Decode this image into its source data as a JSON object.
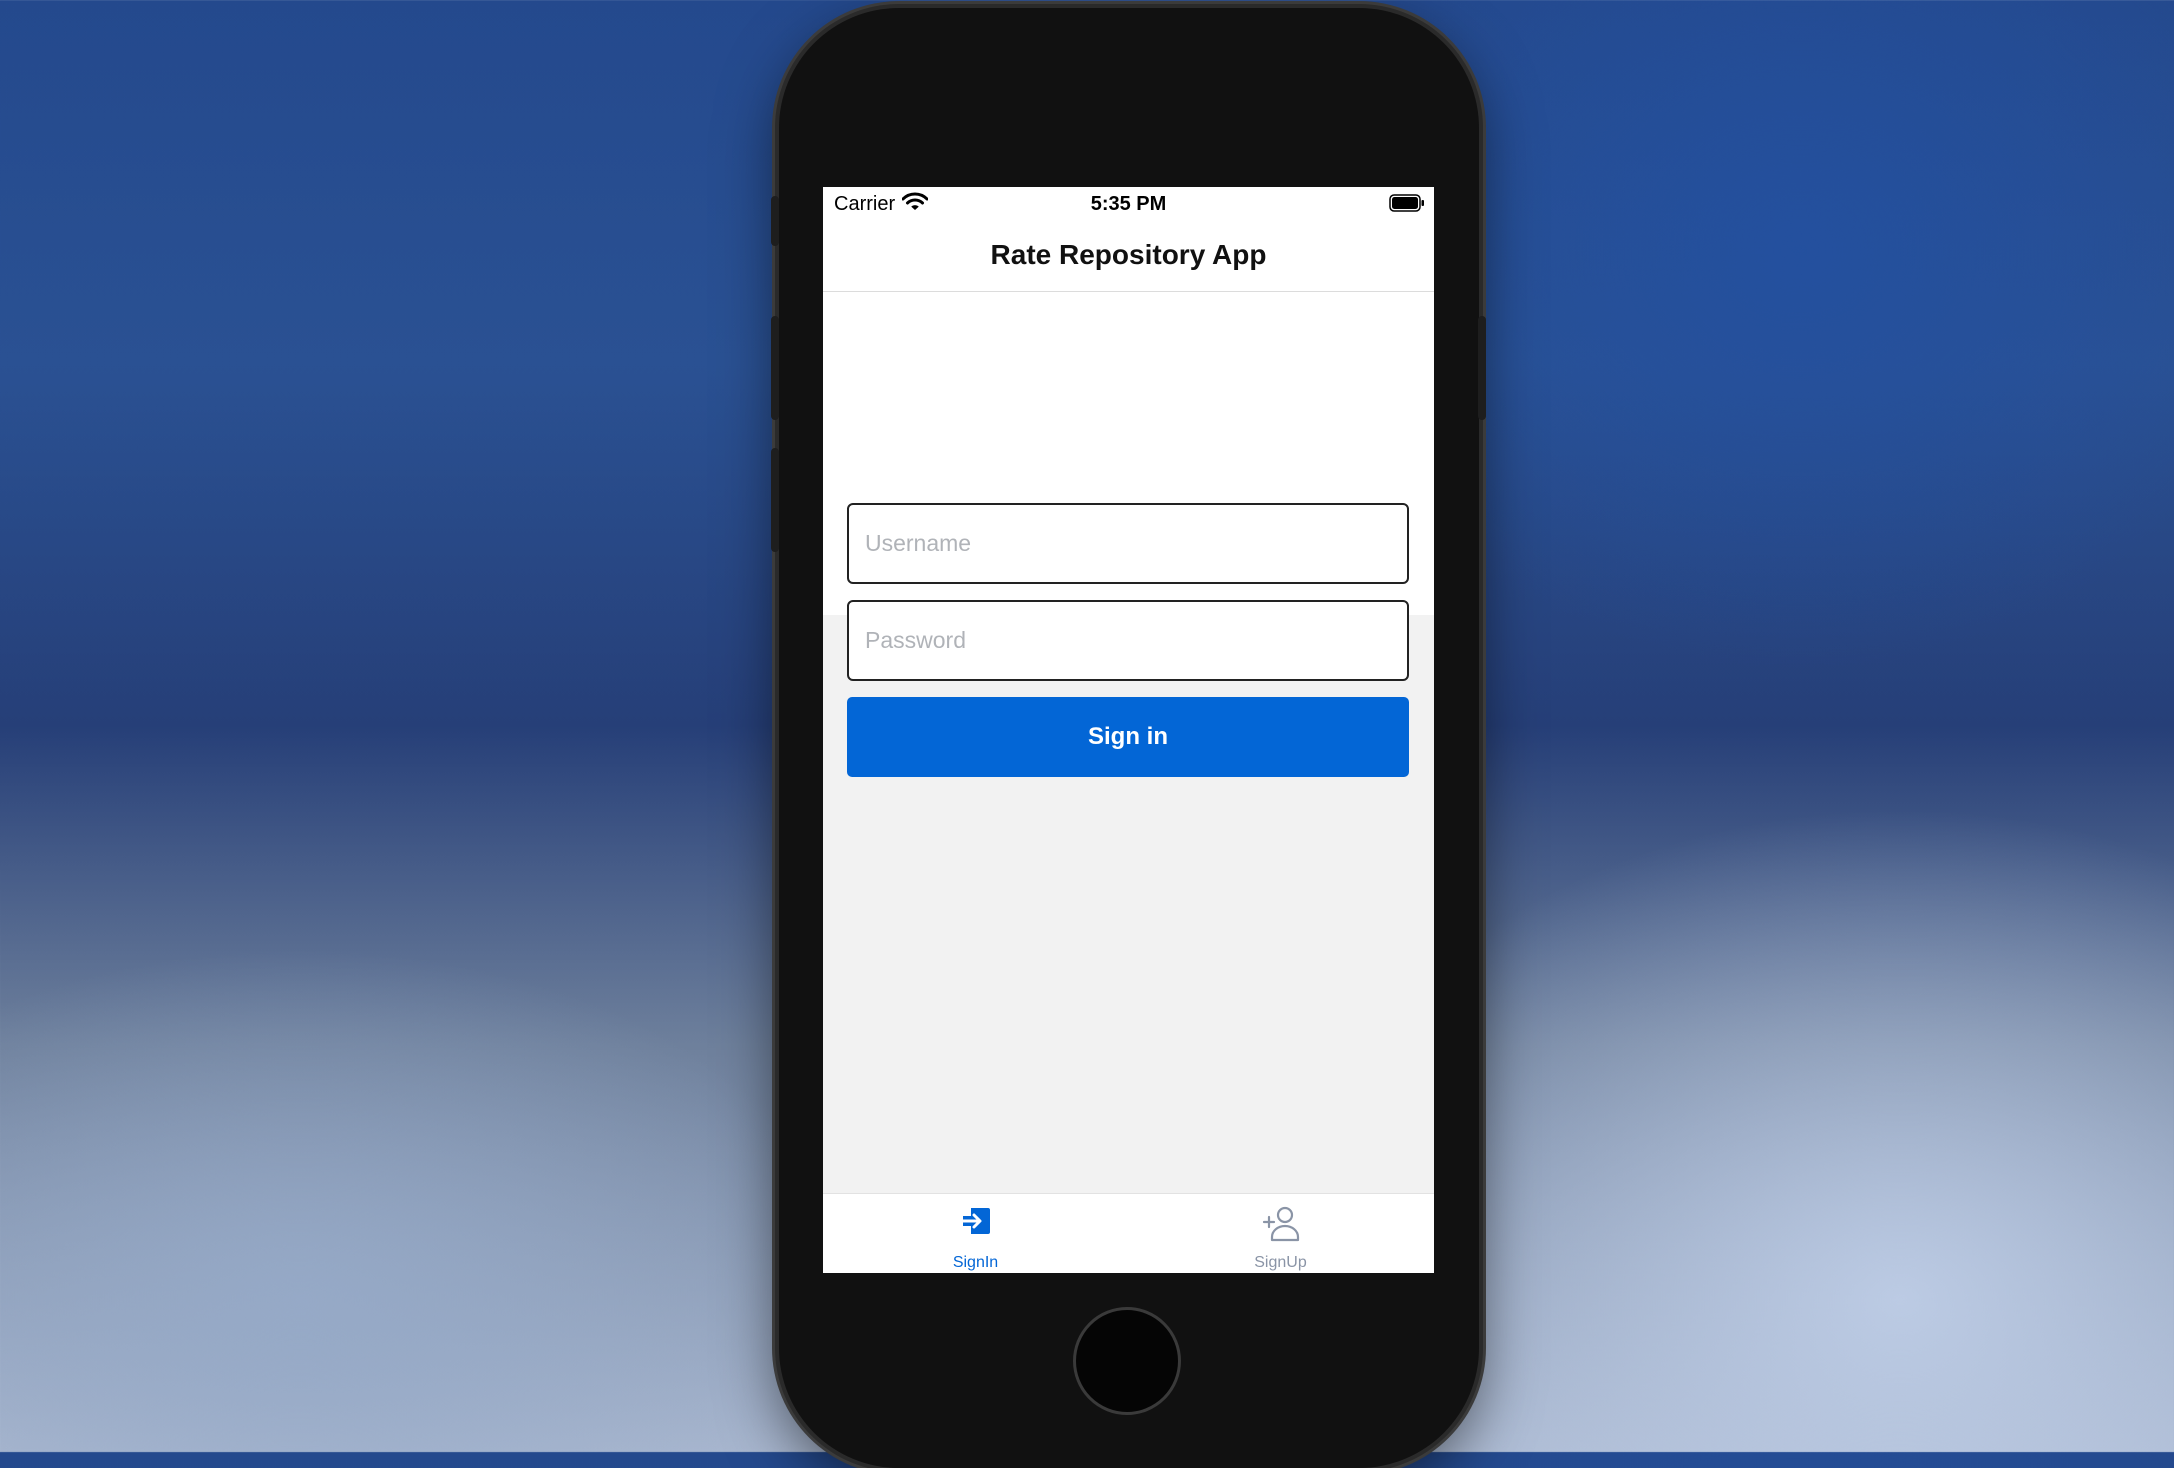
{
  "status_bar": {
    "carrier": "Carrier",
    "time": "5:35 PM"
  },
  "header": {
    "title": "Rate Repository App"
  },
  "form": {
    "username_placeholder": "Username",
    "password_placeholder": "Password",
    "submit_label": "Sign in"
  },
  "tabs": [
    {
      "label": "SignIn",
      "icon": "sign-in-icon",
      "active": true
    },
    {
      "label": "SignUp",
      "icon": "add-user-icon",
      "active": false
    }
  ],
  "colors": {
    "primary": "#0366d6",
    "tab_active": "#0366d6",
    "tab_inactive": "#8a94a6"
  }
}
